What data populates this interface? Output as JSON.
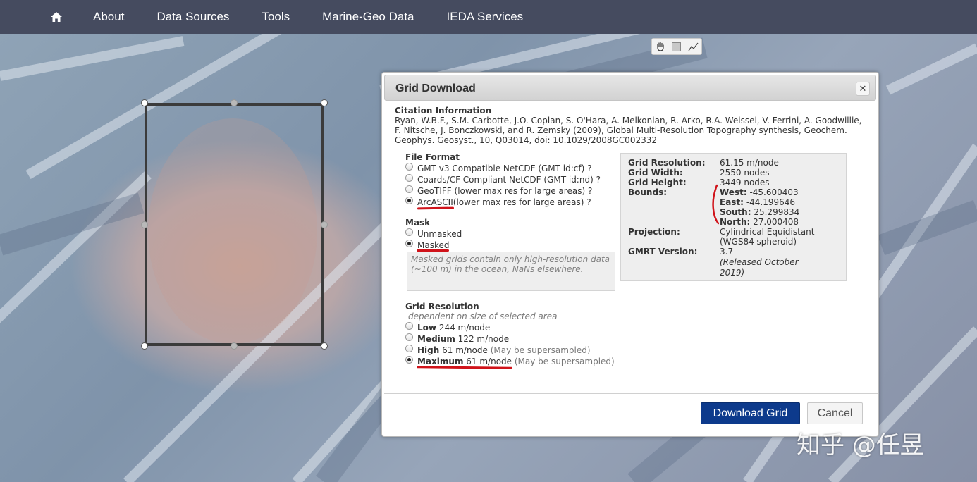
{
  "navbar": {
    "home_icon": "home-icon",
    "items": [
      "About",
      "Data Sources",
      "Tools",
      "Marine-Geo Data",
      "IEDA Services"
    ]
  },
  "map_tools": [
    "pan-hand-icon",
    "rectangle-select-icon",
    "line-profile-icon"
  ],
  "dialog": {
    "title": "Grid Download",
    "close_icon": "close-icon",
    "citation": {
      "heading": "Citation Information",
      "text": "Ryan, W.B.F., S.M. Carbotte, J.O. Coplan, S. O'Hara, A. Melkonian, R. Arko, R.A. Weissel, V. Ferrini, A. Goodwillie, F. Nitsche, J. Bonczkowski, and R. Zemsky (2009), Global Multi-Resolution Topography synthesis, Geochem. Geophys. Geosyst., 10, Q03014, doi: 10.1029/2008GC002332"
    },
    "file_format": {
      "heading": "File Format",
      "options": [
        {
          "label": "GMT v3 Compatible NetCDF (GMT id:cf)",
          "help": "?",
          "selected": false
        },
        {
          "label": "Coards/CF Compliant NetCDF (GMT id:nd)",
          "help": "?",
          "selected": false
        },
        {
          "label": "GeoTIFF (lower max res for large areas)",
          "help": "?",
          "selected": false
        },
        {
          "label": "ArcASCII",
          "suffix": " (lower max res for large areas)",
          "help": "?",
          "selected": true
        }
      ]
    },
    "mask": {
      "heading": "Mask",
      "options": [
        {
          "label": "Unmasked",
          "selected": false
        },
        {
          "label": "Masked",
          "selected": true
        }
      ],
      "note": "Masked grids contain only high-resolution data (~100 m) in the ocean, NaNs elsewhere."
    },
    "info": {
      "grid_resolution_label": "Grid Resolution:",
      "grid_resolution": "61.15 m/node",
      "grid_width_label": "Grid Width:",
      "grid_width": "2550 nodes",
      "grid_height_label": "Grid Height:",
      "grid_height": "3449 nodes",
      "bounds_label": "Bounds:",
      "west_label": "West:",
      "west": "-45.600403",
      "east_label": "East:",
      "east": "-44.199646",
      "south_label": "South:",
      "south": "25.299834",
      "north_label": "North:",
      "north": "27.000408",
      "projection_label": "Projection:",
      "projection_1": "Cylindrical Equidistant",
      "projection_2": "(WGS84 spheroid)",
      "gmrt_label": "GMRT Version:",
      "gmrt_version": "3.7",
      "gmrt_released_1": "(Released October",
      "gmrt_released_2": "2019)"
    },
    "resolution": {
      "heading": "Grid Resolution",
      "subheading": "dependent on size of selected area",
      "options": [
        {
          "name": "Low",
          "value": "244 m/node",
          "note": "",
          "selected": false
        },
        {
          "name": "Medium",
          "value": "122 m/node",
          "note": "",
          "selected": false
        },
        {
          "name": "High",
          "value": "61 m/node",
          "note": "(May be supersampled)",
          "selected": false
        },
        {
          "name": "Maximum",
          "value": "61 m/node",
          "note": "(May be supersampled)",
          "selected": true
        }
      ]
    },
    "buttons": {
      "download": "Download Grid",
      "cancel": "Cancel"
    }
  },
  "watermark": "知乎 @任昱",
  "colors": {
    "navbar": "#454b5f",
    "primary_button": "#0d3a8c",
    "annotation_red": "#d0131a",
    "selection_border": "#3b3b3b"
  }
}
